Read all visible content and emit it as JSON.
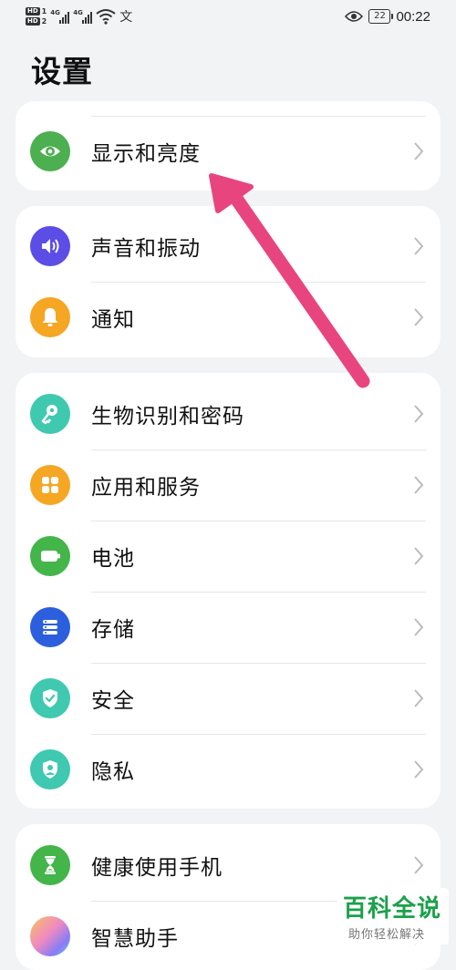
{
  "status_bar": {
    "sim1": "HD",
    "sim1_num": "1",
    "sim2": "HD",
    "sim2_num": "2",
    "network1": "4G",
    "network2": "4G",
    "battery_level": "22",
    "time": "00:22",
    "icons": [
      "signal-icon",
      "wifi-icon",
      "translate-icon",
      "eye-comfort-icon",
      "battery-icon"
    ]
  },
  "page": {
    "title": "设置"
  },
  "groups": [
    {
      "items": [
        {
          "label": "显示和亮度",
          "icon": "eye-icon",
          "color": "#4caf50"
        }
      ]
    },
    {
      "items": [
        {
          "label": "声音和振动",
          "icon": "speaker-icon",
          "color": "#5b4de6"
        },
        {
          "label": "通知",
          "icon": "bell-icon",
          "color": "#f5a623"
        }
      ]
    },
    {
      "items": [
        {
          "label": "生物识别和密码",
          "icon": "key-icon",
          "color": "#3ec9b0"
        },
        {
          "label": "应用和服务",
          "icon": "apps-grid-icon",
          "color": "#f5a623"
        },
        {
          "label": "电池",
          "icon": "battery-icon",
          "color": "#43b549"
        },
        {
          "label": "存储",
          "icon": "storage-icon",
          "color": "#2b5fde"
        },
        {
          "label": "安全",
          "icon": "shield-check-icon",
          "color": "#3ec9b0"
        },
        {
          "label": "隐私",
          "icon": "privacy-shield-icon",
          "color": "#3ec9b0"
        }
      ]
    },
    {
      "items": [
        {
          "label": "健康使用手机",
          "icon": "hourglass-icon",
          "color": "#43b549"
        },
        {
          "label": "智慧助手",
          "icon": "assistant-orb-icon",
          "color": "#f08ac0"
        }
      ]
    }
  ],
  "annotation": {
    "color": "#e8457e"
  },
  "watermark": {
    "title": "百科全说",
    "subtitle": "助你轻松解决"
  }
}
